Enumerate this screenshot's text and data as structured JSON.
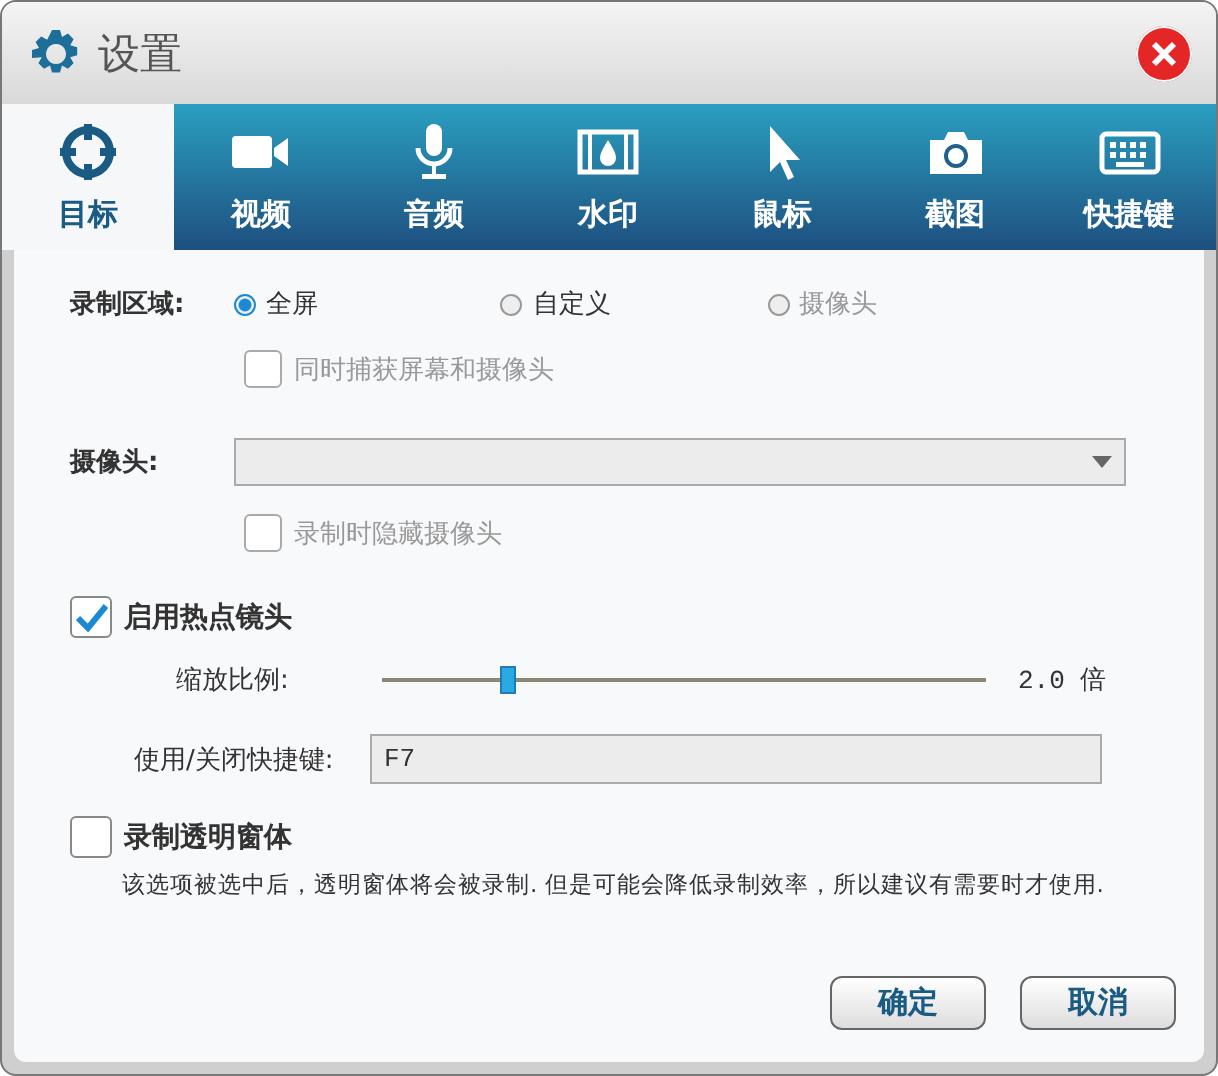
{
  "window": {
    "title": "设置"
  },
  "tabs": [
    {
      "label": "目标",
      "selected": true
    },
    {
      "label": "视频",
      "selected": false
    },
    {
      "label": "音频",
      "selected": false
    },
    {
      "label": "水印",
      "selected": false
    },
    {
      "label": "鼠标",
      "selected": false
    },
    {
      "label": "截图",
      "selected": false
    },
    {
      "label": "快捷键",
      "selected": false
    }
  ],
  "record_area": {
    "label": "录制区域:",
    "options": [
      {
        "label": "全屏",
        "selected": true,
        "disabled": false
      },
      {
        "label": "自定义",
        "selected": false,
        "disabled": false
      },
      {
        "label": "摄像头",
        "selected": false,
        "disabled": true
      }
    ],
    "capture_both": {
      "label": "同时捕获屏幕和摄像头",
      "checked": false,
      "disabled": true
    }
  },
  "camera": {
    "label": "摄像头:",
    "disabled": true,
    "hide_while_recording": {
      "label": "录制时隐藏摄像头",
      "checked": false,
      "disabled": true
    }
  },
  "hotspot": {
    "label": "启用热点镜头",
    "checked": true,
    "zoom_label": "缩放比例:",
    "level": 0.21,
    "reading": "2.0 倍",
    "hotkey_label": "使用/关闭快捷键:",
    "hotkey": "F7"
  },
  "transparent": {
    "label": "录制透明窗体",
    "checked": false,
    "description": "该选项被选中后，透明窗体将会被录制. 但是可能会降低录制效率，所以建议有需要时才使用."
  },
  "buttons": [
    "确定",
    "取消"
  ]
}
